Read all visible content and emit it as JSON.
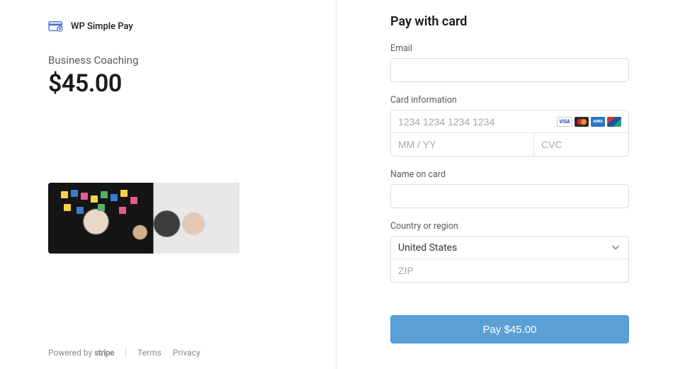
{
  "brand": {
    "name": "WP Simple Pay"
  },
  "product": {
    "name": "Business Coaching",
    "price": "$45.00"
  },
  "footer": {
    "powered_by": "Powered by",
    "stripe": "stripe",
    "terms": "Terms",
    "privacy": "Privacy"
  },
  "checkout": {
    "title": "Pay with card",
    "email_label": "Email",
    "card_info_label": "Card information",
    "card_number_placeholder": "1234 1234 1234 1234",
    "card_expiry_placeholder": "MM / YY",
    "card_cvc_placeholder": "CVC",
    "name_label": "Name on card",
    "country_label": "Country or region",
    "country_value": "United States",
    "zip_placeholder": "ZIP",
    "pay_button": "Pay $45.00"
  }
}
